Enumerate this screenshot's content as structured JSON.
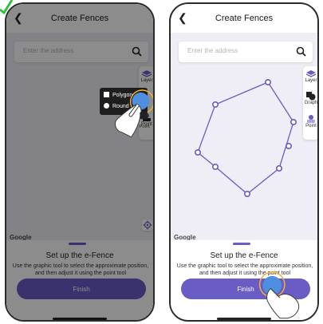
{
  "colors": {
    "accent": "#6a5cc5",
    "map_background": "#efedf5",
    "highlight_ring": "#f2b135",
    "touch_blue": "#4e8fe0",
    "check_green": "#32c040"
  },
  "left_screen": {
    "title": "Create Fences",
    "search_placeholder": "Enter the address",
    "toolbar": {
      "layer_label": "Layer",
      "point_label": "Point"
    },
    "shape_menu": {
      "polygon_label": "Polygon",
      "round_label": "Round"
    },
    "map_attribution": "Google",
    "sheet_title": "Set up the e-Fence",
    "sheet_description": "Use the graphic tool to select the approximate position, and then adjust it using the point tool",
    "finish_label": "Finish"
  },
  "right_screen": {
    "title": "Create Fences",
    "search_placeholder": "Enter the address",
    "toolbar": {
      "layer_label": "Layer",
      "graph_label": "Graph",
      "point_label": "Point"
    },
    "map_attribution": "Google",
    "sheet_title": "Set up the e-Fence",
    "sheet_description": "Use the graphic tool to select the approximate position, and then adjust it using the point tool",
    "finish_label": "Finish"
  },
  "icons": {
    "back": "chevron-left-icon",
    "search": "search-icon",
    "layer": "layers-icon",
    "graph": "shapes-icon",
    "point": "point-pin-icon",
    "locate": "locate-icon",
    "hand": "hand-pointer-icon",
    "check": "check-icon"
  }
}
